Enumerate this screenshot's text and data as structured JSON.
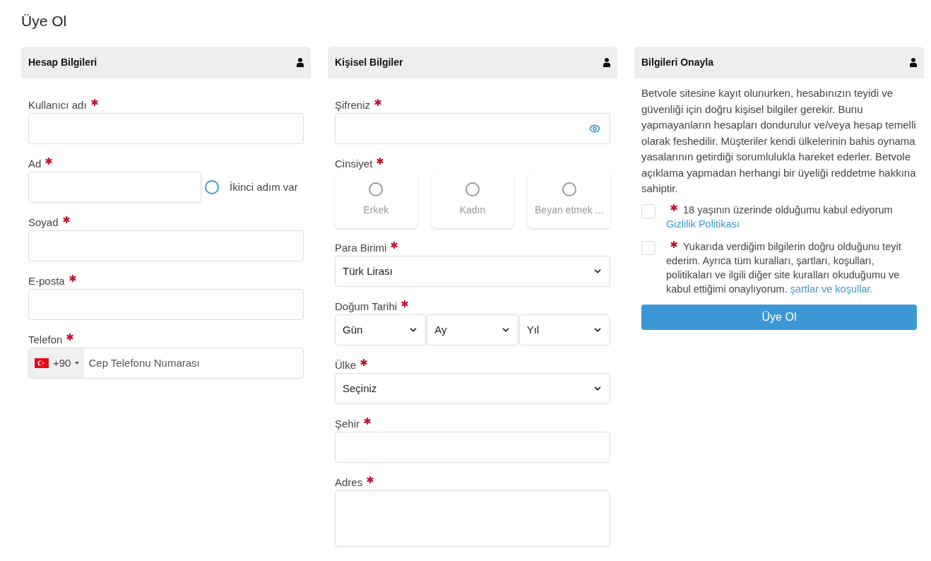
{
  "page_title": "Üye Ol",
  "panels": [
    {
      "title": "Hesap Bilgileri",
      "fields": [
        {
          "kind": "text",
          "label": "Kullanıcı adı",
          "required": true
        },
        {
          "kind": "text_with_radio",
          "label": "Ad",
          "required": true,
          "radio": {
            "label": "İkinci adım var",
            "checked": false
          }
        },
        {
          "kind": "text",
          "label": "Soyad",
          "required": true
        },
        {
          "kind": "text",
          "label": "E-posta",
          "required": true
        },
        {
          "kind": "phone",
          "label": "Telefon",
          "required": true,
          "country_code": "+90",
          "placeholder": "Cep Telefonu Numarası"
        }
      ]
    },
    {
      "title": "Kişisel Bilgiler",
      "fields": [
        {
          "kind": "password",
          "label": "Şifreniz",
          "required": true
        },
        {
          "kind": "gender",
          "label": "Cinsiyet",
          "required": true,
          "options": [
            {
              "label": "Erkek",
              "selected": false
            },
            {
              "label": "Kadın",
              "selected": false
            },
            {
              "label": "Beyan etmek ...",
              "selected": false
            }
          ]
        },
        {
          "kind": "select",
          "label": "Para Birimi",
          "required": true,
          "value": "Türk Lirası"
        },
        {
          "kind": "date",
          "label": "Doğum Tarihi",
          "required": true,
          "parts": [
            "Gün",
            "Ay",
            "Yıl"
          ]
        },
        {
          "kind": "select",
          "label": "Ülke",
          "required": true,
          "value": "Seçiniz"
        },
        {
          "kind": "text",
          "label": "Şehir",
          "required": true
        },
        {
          "kind": "textarea",
          "label": "Adres",
          "required": true
        }
      ]
    }
  ],
  "confirm": {
    "title": "Bilgileri Onayla",
    "intro": "Betvole sitesine kayıt olunurken, hesabınızın teyidi ve güvenliği için doğru kişisel bilgiler gerekir. Bunu yapmayanların hesapları dondurulur ve/veya hesap temelli olarak feshedilir. Müşteriler kendi ülkelerinin bahis oynama yasalarının getirdiği sorumlulukla hareket ederler. Betvole açıklama yapmadan herhangi bir üyeliği reddetme hakkına sahiptir.",
    "agreements": [
      {
        "text": "18 yaşının üzerinde olduğumu kabul ediyorum",
        "link": "Gizlilik Politikası",
        "link_on_new_line": true,
        "required": true,
        "checked": false
      },
      {
        "text": "Yukarıda verdiğim bilgilerin doğru olduğunu teyit ederim. Ayrıca tüm kuralları, şartları, koşulları, politikaları ve ilgili diğer site kuralları okuduğumu ve kabul ettiğimi onaylıyorum.",
        "link": "şartlar ve koşullar.",
        "link_on_new_line": false,
        "required": true,
        "checked": false
      }
    ],
    "submit": "Üye Ol"
  }
}
